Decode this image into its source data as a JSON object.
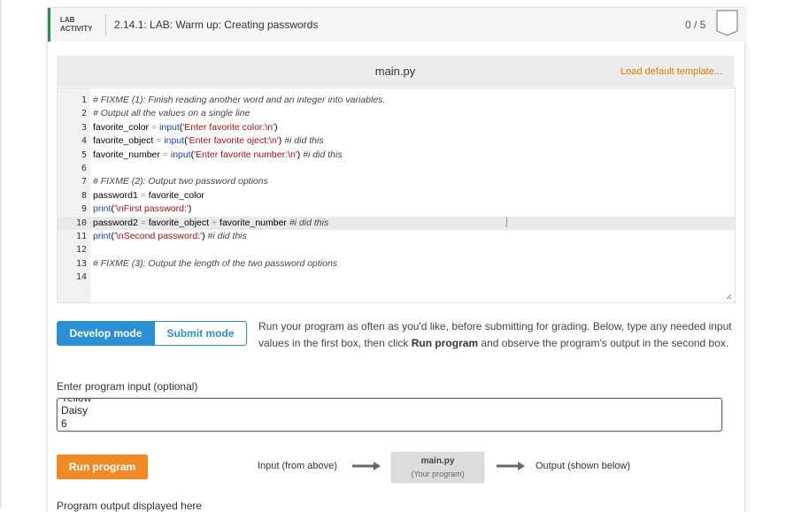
{
  "activity": {
    "type_label_line1": "LAB",
    "type_label_line2": "ACTIVITY",
    "title": "2.14.1: LAB: Warm up: Creating passwords",
    "score": "0 / 5"
  },
  "editor": {
    "file_name": "main.py",
    "load_template_label": "Load default template...",
    "active_line": 10,
    "lines": [
      {
        "n": "1",
        "parts": [
          {
            "t": "# FIXME (1): Finish reading another word and an integer into variables.",
            "c": "cm"
          }
        ]
      },
      {
        "n": "2",
        "parts": [
          {
            "t": "# Output all the values on a single line",
            "c": "cm"
          }
        ]
      },
      {
        "n": "3",
        "parts": [
          {
            "t": "favorite_color ",
            "c": ""
          },
          {
            "t": "=",
            "c": "op"
          },
          {
            "t": " ",
            "c": ""
          },
          {
            "t": "input",
            "c": "kw"
          },
          {
            "t": "(",
            "c": ""
          },
          {
            "t": "'Enter favorite color:\\n'",
            "c": "str"
          },
          {
            "t": ")",
            "c": ""
          }
        ]
      },
      {
        "n": "4",
        "parts": [
          {
            "t": "favorite_object ",
            "c": ""
          },
          {
            "t": "=",
            "c": "op"
          },
          {
            "t": " ",
            "c": ""
          },
          {
            "t": "input",
            "c": "kw"
          },
          {
            "t": "(",
            "c": ""
          },
          {
            "t": "'Enter favorite oject:\\n'",
            "c": "str"
          },
          {
            "t": ") ",
            "c": ""
          },
          {
            "t": "#i did this",
            "c": "cm"
          }
        ]
      },
      {
        "n": "5",
        "parts": [
          {
            "t": "favorite_number ",
            "c": ""
          },
          {
            "t": "=",
            "c": "op"
          },
          {
            "t": " ",
            "c": ""
          },
          {
            "t": "input",
            "c": "kw"
          },
          {
            "t": "(",
            "c": ""
          },
          {
            "t": "'Enter favorite number:\\n'",
            "c": "str"
          },
          {
            "t": ") ",
            "c": ""
          },
          {
            "t": "#i did this",
            "c": "cm"
          }
        ]
      },
      {
        "n": "6",
        "parts": []
      },
      {
        "n": "7",
        "parts": [
          {
            "t": "# FIXME (2): Output two password options",
            "c": "cm"
          }
        ]
      },
      {
        "n": "8",
        "parts": [
          {
            "t": "password1 ",
            "c": ""
          },
          {
            "t": "=",
            "c": "op"
          },
          {
            "t": " favorite_color",
            "c": ""
          }
        ]
      },
      {
        "n": "9",
        "parts": [
          {
            "t": "print",
            "c": "kw"
          },
          {
            "t": "(",
            "c": ""
          },
          {
            "t": "'\\nFirst password:'",
            "c": "str"
          },
          {
            "t": ")",
            "c": ""
          }
        ]
      },
      {
        "n": "10",
        "parts": [
          {
            "t": "password2 ",
            "c": ""
          },
          {
            "t": "=",
            "c": "op"
          },
          {
            "t": " favorite_object ",
            "c": ""
          },
          {
            "t": "+",
            "c": "op"
          },
          {
            "t": " favorite_number ",
            "c": ""
          },
          {
            "t": "#i did this",
            "c": "cm"
          }
        ]
      },
      {
        "n": "11",
        "parts": [
          {
            "t": "print",
            "c": "kw"
          },
          {
            "t": "(",
            "c": ""
          },
          {
            "t": "'\\nSecond password:'",
            "c": "str"
          },
          {
            "t": ") ",
            "c": ""
          },
          {
            "t": "#i did this",
            "c": "cm"
          }
        ]
      },
      {
        "n": "12",
        "parts": []
      },
      {
        "n": "13",
        "parts": [
          {
            "t": "# FIXME (3): Output the length of the two password options",
            "c": "cm"
          }
        ]
      },
      {
        "n": "14",
        "parts": []
      }
    ]
  },
  "modes": {
    "develop_label": "Develop mode",
    "submit_label": "Submit mode",
    "active": "develop"
  },
  "run_info": {
    "text_before": "Run your program as often as you'd like, before submitting for grading. Below, type any needed input values in the first box, then click ",
    "bold": "Run program",
    "text_after": " and observe the program's output in the second box."
  },
  "program_input": {
    "label": "Enter program input (optional)",
    "lines": [
      "Yellow",
      "Daisy",
      "6"
    ]
  },
  "run": {
    "button_label": "Run program",
    "flow_input_label": "Input (from above)",
    "flow_box_main": "main.py",
    "flow_box_sub": "(Your program)",
    "flow_output_label": "Output (shown below)"
  },
  "output": {
    "label": "Program output displayed here"
  },
  "colors": {
    "accent_blue": "#2b8fd6",
    "run_orange": "#f08a24",
    "template_link": "#e07b00",
    "lab_border_green": "#2d8a52"
  }
}
